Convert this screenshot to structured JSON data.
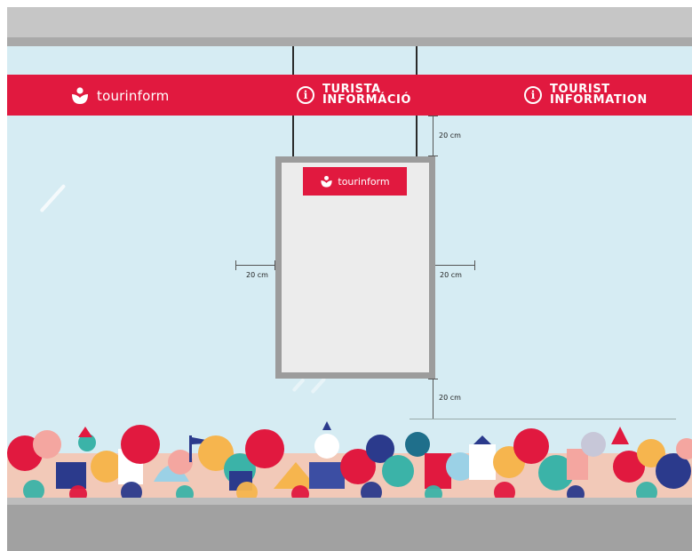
{
  "banner": {
    "brand": "tourinform",
    "info_hu": [
      "TURISTA",
      "INFORMÁCIÓ"
    ],
    "info_en": [
      "TOURIST",
      "INFORMATION"
    ]
  },
  "panel": {
    "brand": "tourinform"
  },
  "dimensions": {
    "top_gap": "20 cm",
    "left_gap": "20 cm",
    "right_gap": "20 cm",
    "bottom_gap": "20 cm"
  },
  "colors": {
    "brand_red": "#e1193f",
    "glass": "#d6ecf3",
    "frame_gray": "#9c9c9c"
  },
  "icons": {
    "logo": "tourinform-logo-icon",
    "info": "info-icon"
  }
}
